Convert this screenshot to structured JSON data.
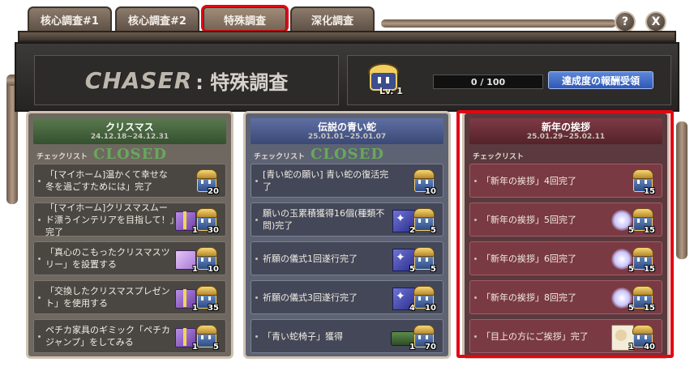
{
  "tabs": [
    {
      "label": "核心調査#1",
      "active": false
    },
    {
      "label": "核心調査#2",
      "active": false
    },
    {
      "label": "特殊調査",
      "active": true,
      "highlighted": true
    },
    {
      "label": "深化調査",
      "active": false
    }
  ],
  "controls": {
    "help": "?",
    "close": "X"
  },
  "header": {
    "chaser": "CHASER",
    "subtitle": ": 特殊調査",
    "level": "Lv. 1",
    "progress": "0  /  100",
    "reward_button": "達成度の報酬受領"
  },
  "colors": {
    "highlight": "#e30613",
    "reward_button": "#2f58b5",
    "closed": "#67a85b"
  },
  "panels": [
    {
      "title": "クリスマス",
      "dates": "24.12.18~24.12.31",
      "checklist_label": "チェックリスト",
      "status": "CLOSED",
      "items": [
        {
          "text": "「[マイホーム]温かくて幸せな冬を過ごすためには」完了",
          "rewards": [
            {
              "icon": "chest-icon",
              "count": "20"
            }
          ]
        },
        {
          "text": "「[マイホーム]クリスマスムード漂うインテリアを目指して！」完了",
          "rewards": [
            {
              "icon": "gift-box-icon",
              "count": "1"
            },
            {
              "icon": "chest-icon",
              "count": "30"
            }
          ]
        },
        {
          "text": "「真心のこもったクリスマスツリー」を設置する",
          "rewards": [
            {
              "icon": "gift-box-icon",
              "count": "1"
            },
            {
              "icon": "chest-icon",
              "count": "10"
            }
          ]
        },
        {
          "text": "「交換したクリスマスプレゼント」を使用する",
          "rewards": [
            {
              "icon": "gift-box-icon",
              "count": "1"
            },
            {
              "icon": "chest-icon",
              "count": "35"
            }
          ]
        },
        {
          "text": "ペチカ家具のギミック「ペチカジャンプ」をしてみる",
          "rewards": [
            {
              "icon": "gift-box-icon",
              "count": "1"
            },
            {
              "icon": "chest-icon",
              "count": "5"
            }
          ]
        }
      ]
    },
    {
      "title": "伝説の青い蛇",
      "dates": "25.01.01~25.01.07",
      "checklist_label": "チェックリスト",
      "status": "CLOSED",
      "items": [
        {
          "text": "[青い蛇の願い] 青い蛇の復活完了",
          "rewards": [
            {
              "icon": "chest-icon",
              "count": "10"
            }
          ]
        },
        {
          "text": "願いの玉累積獲得16個(種類不問)完了",
          "rewards": [
            {
              "icon": "scroll-icon",
              "count": "2"
            },
            {
              "icon": "chest-icon",
              "count": "5"
            }
          ]
        },
        {
          "text": "祈願の儀式1回遂行完了",
          "rewards": [
            {
              "icon": "scroll-icon",
              "count": "5"
            },
            {
              "icon": "chest-icon",
              "count": "5"
            }
          ]
        },
        {
          "text": "祈願の儀式3回遂行完了",
          "rewards": [
            {
              "icon": "scroll-icon",
              "count": "4"
            },
            {
              "icon": "chest-icon",
              "count": "10"
            }
          ]
        },
        {
          "text": "「青い蛇椅子」獲得",
          "rewards": [
            {
              "icon": "chair-icon",
              "count": "1"
            },
            {
              "icon": "chest-icon",
              "count": "70"
            }
          ]
        }
      ]
    },
    {
      "title": "新年の挨拶",
      "dates": "25.01.29~25.02.11",
      "checklist_label": "チェックリスト",
      "status": "",
      "items": [
        {
          "text": "「新年の挨拶」4回完了",
          "rewards": [
            {
              "icon": "chest-icon",
              "count": "15"
            }
          ]
        },
        {
          "text": "「新年の挨拶」5回完了",
          "rewards": [
            {
              "icon": "glow-icon",
              "count": "5"
            },
            {
              "icon": "chest-icon",
              "count": "15"
            }
          ]
        },
        {
          "text": "「新年の挨拶」6回完了",
          "rewards": [
            {
              "icon": "glow-icon",
              "count": "5"
            },
            {
              "icon": "chest-icon",
              "count": "15"
            }
          ]
        },
        {
          "text": "「新年の挨拶」8回完了",
          "rewards": [
            {
              "icon": "glow-icon",
              "count": "5"
            },
            {
              "icon": "chest-icon",
              "count": "15"
            }
          ]
        },
        {
          "text": "「目上の方にご挨拶」完了",
          "rewards": [
            {
              "icon": "card-icon",
              "count": "1"
            },
            {
              "icon": "chest-icon",
              "count": "40"
            }
          ]
        }
      ]
    }
  ]
}
